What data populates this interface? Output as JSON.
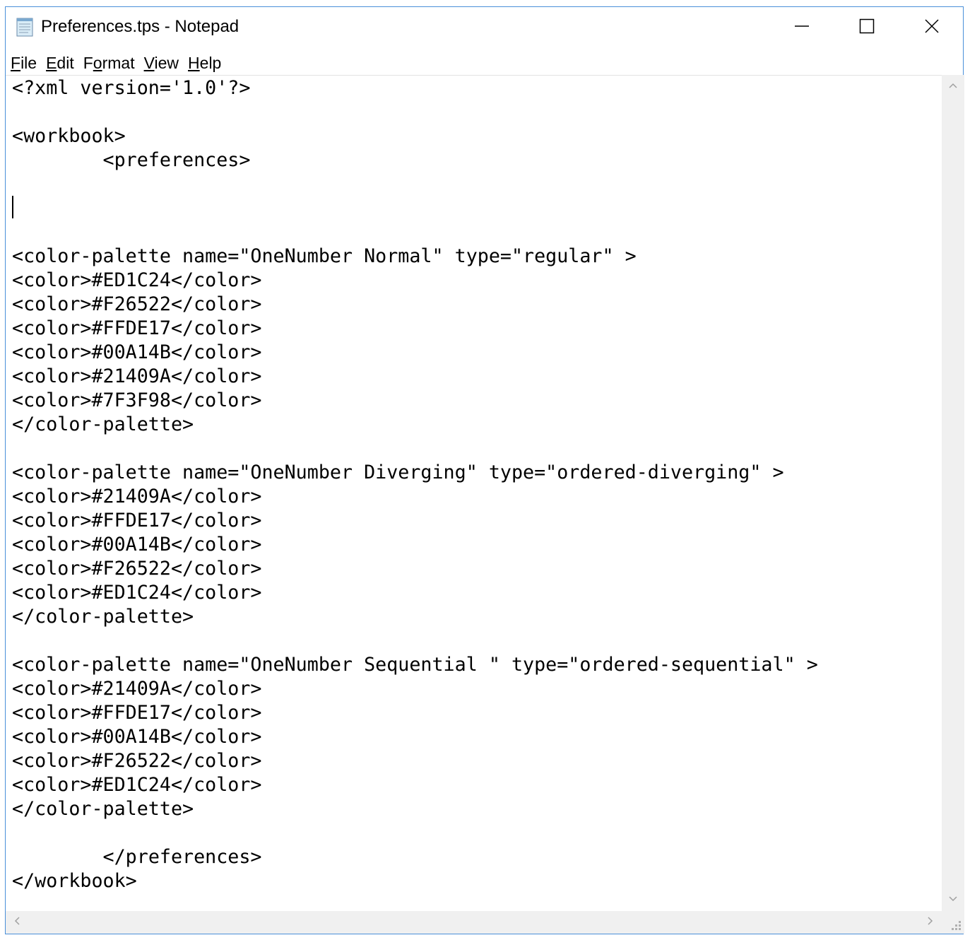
{
  "window": {
    "title": "Preferences.tps - Notepad",
    "icon": "notepad-icon",
    "controls": {
      "minimize_icon": "minimize-icon",
      "maximize_icon": "maximize-icon",
      "close_icon": "close-icon"
    },
    "border_color": "#4a90d9"
  },
  "menubar": {
    "items": [
      {
        "accelerator": "F",
        "rest": "ile"
      },
      {
        "accelerator": "E",
        "rest": "dit"
      },
      {
        "accelerator": "",
        "rest": "Format",
        "acc_inner": "o"
      },
      {
        "accelerator": "V",
        "rest": "iew"
      },
      {
        "accelerator": "H",
        "rest": "elp"
      }
    ],
    "labels": [
      "File",
      "Edit",
      "Format",
      "View",
      "Help"
    ]
  },
  "editor": {
    "content": "<?xml version='1.0'?>\n\n<workbook>\n\t<preferences>\n\n\n\n<color-palette name=\"OneNumber Normal\" type=\"regular\" >\n<color>#ED1C24</color>\n<color>#F26522</color>\n<color>#FFDE17</color>\n<color>#00A14B</color>\n<color>#21409A</color>\n<color>#7F3F98</color>\n</color-palette>\n\n<color-palette name=\"OneNumber Diverging\" type=\"ordered-diverging\" >\n<color>#21409A</color>\n<color>#FFDE17</color>\n<color>#00A14B</color>\n<color>#F26522</color>\n<color>#ED1C24</color>\n</color-palette>\n\n<color-palette name=\"OneNumber Sequential \" type=\"ordered-sequential\" >\n<color>#21409A</color>\n<color>#FFDE17</color>\n<color>#00A14B</color>\n<color>#F26522</color>\n<color>#ED1C24</color>\n</color-palette>\n\n\t</preferences>\n</workbook>"
  },
  "scrollbars": {
    "up_icon": "chevron-up-icon",
    "down_icon": "chevron-down-icon",
    "left_icon": "chevron-left-icon",
    "right_icon": "chevron-right-icon",
    "grip_icon": "resize-grip-icon"
  }
}
